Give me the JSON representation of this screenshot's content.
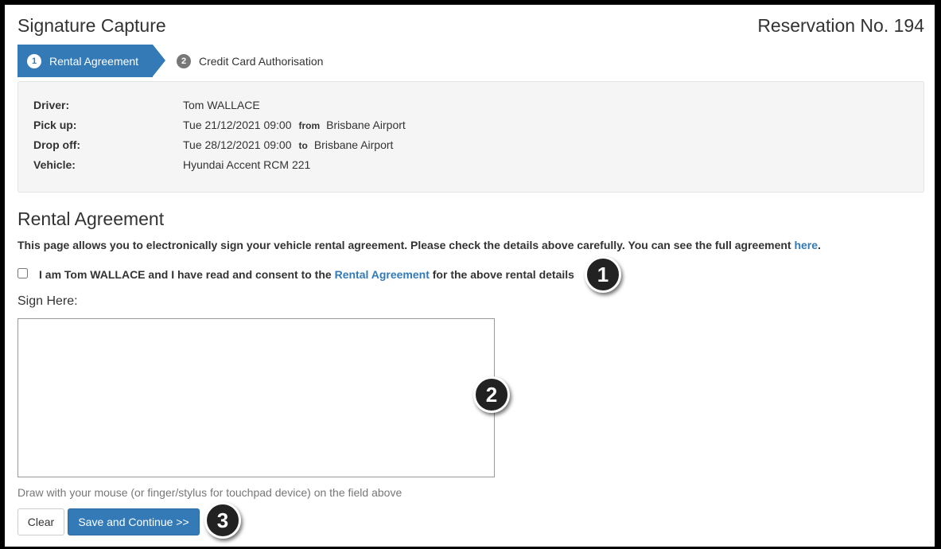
{
  "header": {
    "title": "Signature Capture",
    "reservation": "Reservation No. 194"
  },
  "steps": [
    {
      "number": "1",
      "label": "Rental Agreement",
      "active": true
    },
    {
      "number": "2",
      "label": "Credit Card Authorisation",
      "active": false
    }
  ],
  "details": {
    "driver_label": "Driver:",
    "driver": "Tom WALLACE",
    "pickup_label": "Pick up:",
    "pickup_time": "Tue 21/12/2021 09:00",
    "pickup_from": "from",
    "pickup_location": "Brisbane Airport",
    "dropoff_label": "Drop off:",
    "dropoff_time": "Tue 28/12/2021 09:00",
    "dropoff_to": "to",
    "dropoff_location": "Brisbane Airport",
    "vehicle_label": "Vehicle:",
    "vehicle": "Hyundai Accent RCM 221"
  },
  "agreement": {
    "title": "Rental Agreement",
    "intro": "This page allows you to electronically sign your vehicle rental agreement. Please check the details above carefully. You can see the full agreement",
    "intro_link": "here",
    "intro_end": ".",
    "consent_pre": "I am Tom WALLACE and I have read and consent to the",
    "consent_link": "Rental Agreement",
    "consent_post": "for the above rental details",
    "consent_checked": false
  },
  "signature": {
    "label": "Sign Here:",
    "hint": "Draw with your mouse (or finger/stylus for touchpad device) on the field above"
  },
  "buttons": {
    "clear": "Clear",
    "save": "Save and Continue >>"
  },
  "markers": [
    "1",
    "2",
    "3"
  ],
  "colors": {
    "primary": "#337ab7",
    "well_bg": "#f5f5f5",
    "step_inactive_bg": "#ebebeb"
  }
}
